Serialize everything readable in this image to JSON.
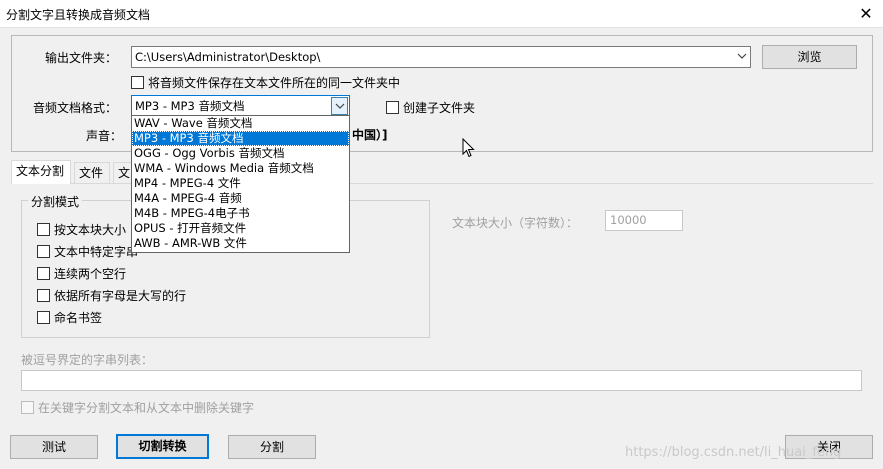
{
  "window": {
    "title": "分割文字且转换成音频文档",
    "close_glyph": "✕"
  },
  "output": {
    "label": "输出文件夹：",
    "path": "C:\\Users\\Administrator\\Desktop\\",
    "browse_label": "浏览",
    "same_folder_label": "将音频文件保存在文本文件所在的同一文件夹中"
  },
  "format": {
    "label": "音频文档格式：",
    "selected": "MP3 - MP3 音频文档",
    "create_subfolder_label": "创建子文件夹",
    "options": [
      "WAV - Wave 音频文档",
      "MP3 - MP3 音频文档",
      "OGG - Ogg Vorbis 音频文档",
      "WMA - Windows Media 音频文档",
      "MP4 - MPEG-4 文件",
      "M4A - MPEG-4 音频",
      "M4B - MPEG-4电子书",
      "OPUS - 打开音频文件",
      "AWB - AMR-WB 文件"
    ],
    "selected_index": 1
  },
  "voice": {
    "label": "声音：",
    "value_tail": "，中国）]"
  },
  "tabs": [
    "文本分割",
    "文件",
    "文"
  ],
  "split_mode": {
    "legend": "分割模式",
    "options": [
      "按文本块大小",
      "文本中特定字串",
      "连续两个空行",
      "依据所有字母是大写的行",
      "命名书签"
    ],
    "block_size_label": "文本块大小（字符数）：",
    "block_size_value": "10000",
    "comma_list_label": "被逗号界定的字串列表：",
    "comma_list_value": "",
    "keyword_split_label": "在关键字分割文本和从文本中删除关键字"
  },
  "buttons": {
    "test": "测试",
    "split_convert": "切割转换",
    "split": "分割",
    "close": "关闭"
  },
  "watermark": "https://blog.csdn.net/li_huai_feng"
}
